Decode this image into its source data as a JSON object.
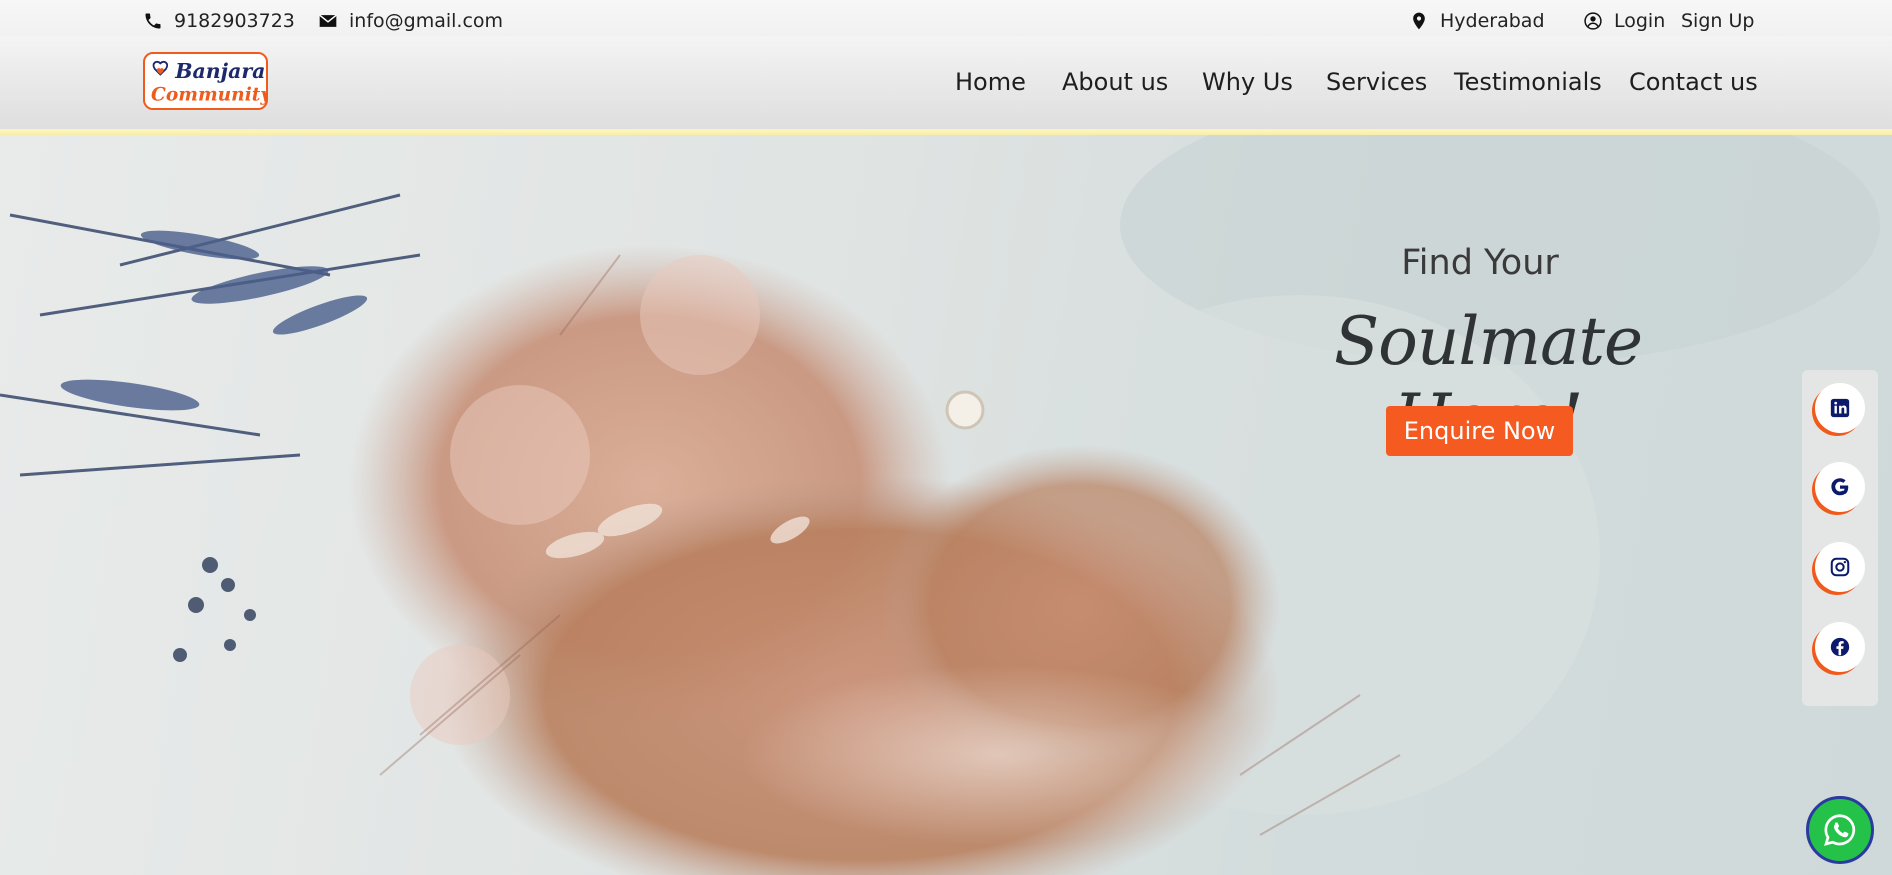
{
  "topbar": {
    "phone": "9182903723",
    "email": "info@gmail.com",
    "city": "Hyderabad",
    "login": "Login",
    "signup": "Sign Up"
  },
  "logo": {
    "line1": "Banjara",
    "line2": "Community"
  },
  "nav": {
    "items": [
      {
        "label": "Home"
      },
      {
        "label": "About us"
      },
      {
        "label": "Why Us"
      },
      {
        "label": "Services"
      },
      {
        "label": "Testimonials"
      },
      {
        "label": "Contact us"
      }
    ]
  },
  "hero": {
    "line1": "Find Your",
    "line2": "Soulmate Here!",
    "cta": "Enquire Now"
  },
  "social": [
    {
      "icon": "linkedin-icon"
    },
    {
      "icon": "google-icon"
    },
    {
      "icon": "instagram-icon"
    },
    {
      "icon": "facebook-icon"
    }
  ],
  "colors": {
    "accent": "#f55a21",
    "brand_navy": "#1c2a6b",
    "whatsapp": "#25c24a"
  }
}
